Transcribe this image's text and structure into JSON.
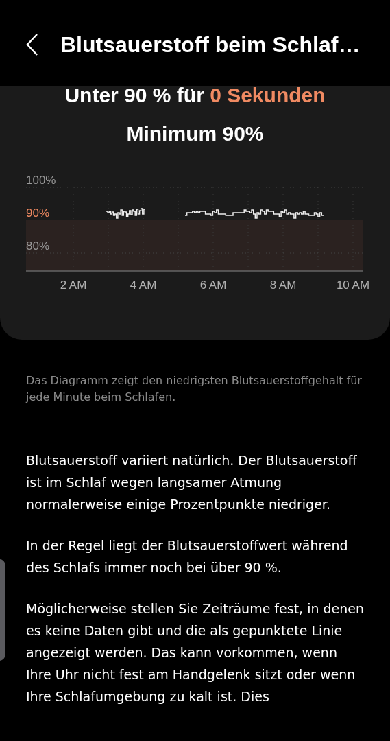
{
  "header": {
    "title": "Blutsauerstoff beim Schlaf…"
  },
  "summary": {
    "duration_prefix": "Unter 90 % für ",
    "duration_value": "0 Sekunden",
    "minimum": "Minimum 90%"
  },
  "chart": {
    "y_labels": [
      {
        "label": "100%",
        "highlighted": false
      },
      {
        "label": "90%",
        "highlighted": true
      },
      {
        "label": "80%",
        "highlighted": false
      }
    ],
    "x_labels": [
      "2 AM",
      "4 AM",
      "6 AM",
      "8 AM",
      "10 AM"
    ]
  },
  "caption": "Das Diagramm zeigt den niedrigsten Blutsauerstoffgehalt für jede Minute beim Schlafen.",
  "paragraphs": [
    "Blutsauerstoff variiert natürlich. Der Blutsauerstoff ist im Schlaf wegen langsamer Atmung normalerweise einige Prozentpunkte niedriger.",
    "In der Regel liegt der Blutsauerstoffwert während des Schlafs immer noch bei über 90 %.",
    "Möglicherweise stellen Sie Zeiträume fest, in denen es keine Daten gibt und die als gepunktete Linie angezeigt werden. Das kann vorkommen, wenn Ihre Uhr nicht fest am Handgelenk sitzt oder wenn Ihre Schlafumgebung zu kalt ist. Dies"
  ]
}
